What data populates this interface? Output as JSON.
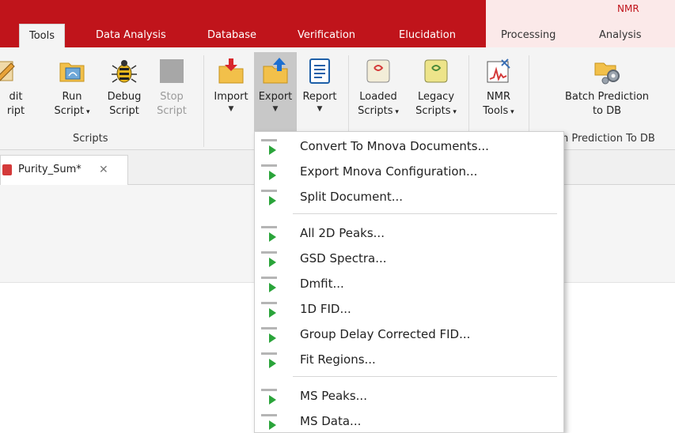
{
  "ribbon_tabs": {
    "tools": "Tools",
    "data_analysis": "Data Analysis",
    "database": "Database",
    "verification": "Verification",
    "elucidation": "Elucidation",
    "processing": "Processing",
    "analysis": "Analysis",
    "context_group": "NMR"
  },
  "ribbon_buttons": {
    "edit_script": [
      "dit",
      "ript"
    ],
    "run_script": [
      "Run",
      "Script"
    ],
    "debug_script": [
      "Debug",
      "Script"
    ],
    "stop_script": [
      "Stop",
      "Script"
    ],
    "import": "Import",
    "export": "Export",
    "report": "Report",
    "loaded_scripts": [
      "Loaded",
      "Scripts"
    ],
    "legacy_scripts": [
      "Legacy",
      "Scripts"
    ],
    "nmr_tools": [
      "NMR",
      "Tools"
    ],
    "batch_prediction": [
      "Batch Prediction",
      "to DB"
    ]
  },
  "group_labels": {
    "scripts": "Scripts",
    "batch_prediction": "h Prediction To DB"
  },
  "document_tab": {
    "label": "Purity_Sum*",
    "close": "✕"
  },
  "export_menu": {
    "items": [
      "Convert To Mnova Documents...",
      "Export Mnova Configuration...",
      "Split Document...",
      "All 2D Peaks...",
      "GSD Spectra...",
      "Dmfit...",
      "1D FID...",
      "Group Delay Corrected FID...",
      "Fit Regions...",
      "MS Peaks...",
      "MS Data..."
    ]
  },
  "colors": {
    "ribbon_red": "#c0141b",
    "menu_play_green": "#2aa43a"
  },
  "icons": {
    "edit_script": "pencil-script-icon",
    "run_script": "folder-run-icon",
    "debug_script": "bug-icon",
    "stop_script": "stop-square-icon",
    "import": "folder-import-icon",
    "export": "folder-export-icon",
    "report": "report-document-icon",
    "loaded_scripts": "scroll-icon",
    "legacy_scripts": "legacy-scroll-icon",
    "nmr_tools": "nmr-tools-icon",
    "batch_prediction": "folder-gears-icon",
    "menu_item": "play-script-icon"
  }
}
